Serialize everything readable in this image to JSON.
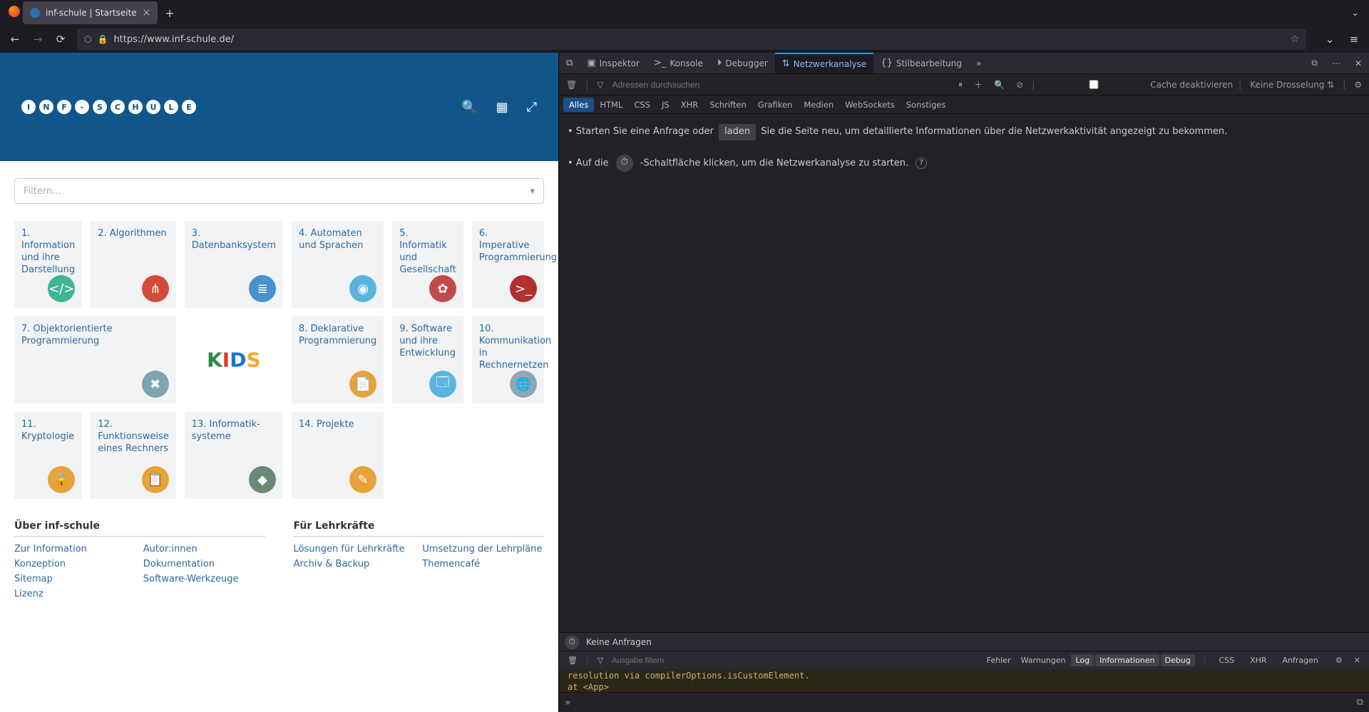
{
  "browser": {
    "tabTitle": "inf-schule | Startseite",
    "url": "https://www.inf-schule.de/",
    "newTab": "+",
    "nav": {
      "back": "←",
      "forward": "→",
      "reload": "⟳"
    }
  },
  "page": {
    "logoLetters": [
      "I",
      "N",
      "F",
      "-",
      "S",
      "C",
      "H",
      "U",
      "L",
      "E"
    ],
    "filterPlaceholder": "Filtern…",
    "tiles": [
      {
        "t": "1. Information und ihre Darstellung",
        "c": "#3fb597",
        "g": "</>"
      },
      {
        "t": "2. Algorithmen",
        "c": "#d14b3a",
        "g": "⋔"
      },
      {
        "t": "3. Datenbanksystem",
        "c": "#4b90cf",
        "g": "≣"
      },
      {
        "t": "4. Automaten und Sprachen",
        "c": "#5bb4e0",
        "g": "◉"
      },
      {
        "t": "5. Informatik und Gesellschaft",
        "c": "#c34a4a",
        "g": "✿"
      },
      {
        "t": "6. Imperative Programmierung",
        "c": "#b33030",
        "g": ">_",
        "wide": true
      },
      {
        "t": "7. Objektorientierte Programmierung",
        "c": "#7da4b3",
        "g": "✖",
        "wide": true
      },
      {
        "kids": true,
        "white": true
      },
      {
        "t": "8. Deklarative Programmierung",
        "c": "#e8a23a",
        "g": "📄"
      },
      {
        "t": "9. Software und ihre Entwicklung",
        "c": "#5bb4e0",
        "g": "🗔"
      },
      {
        "t": "10. Kommunikation in Rechnernetzen",
        "c": "#8fa7b3",
        "g": "🌐",
        "wide": true
      },
      {
        "t": "11. Kryptologie",
        "c": "#e8a23a",
        "g": "🔒"
      },
      {
        "t": "12. Funktionsweise eines Rechners",
        "c": "#e8a23a",
        "g": "📋"
      },
      {
        "t": "13. Informatik­systeme",
        "c": "#6a8a74",
        "g": "◆"
      },
      {
        "t": "14. Projekte",
        "c": "#e8a23a",
        "g": "✎"
      }
    ],
    "footer": {
      "about": {
        "h": "Über inf-schule",
        "links": [
          "Zur Information",
          "Autor:innen",
          "Konzeption",
          "Dokumentation",
          "Sitemap",
          "Software-Werkzeuge",
          "Lizenz"
        ]
      },
      "teach": {
        "h": "Für Lehrkräfte",
        "links": [
          "Lösungen für Lehrkräfte",
          "Umsetzung der Lehrpläne",
          "Archiv & Backup",
          "Themencafé"
        ]
      }
    }
  },
  "devtools": {
    "tabs": [
      "Inspektor",
      "Konsole",
      "Debugger",
      "Netzwerkanalyse",
      "Stilbearbeitung"
    ],
    "activeTab": "Netzwerkanalyse",
    "toolbar": {
      "searchPlaceholder": "Adressen durchsuchen",
      "cacheLabel": "Cache deaktivieren",
      "throttleLabel": "Keine Drosselung"
    },
    "filters": [
      "Alles",
      "HTML",
      "CSS",
      "JS",
      "XHR",
      "Schriften",
      "Grafiken",
      "Medien",
      "WebSockets",
      "Sonstiges"
    ],
    "msg1a": "• Starten Sie eine Anfrage oder",
    "msg1btn": "laden",
    "msg1b": "Sie die Seite neu, um detaillierte Informationen über die Netzwerkaktivität angezeigt zu bekommen.",
    "msg2a": "• Auf die",
    "msg2b": "-Schaltfläche klicken, um die Netzwerkanalyse zu starten.",
    "status": "Keine Anfragen",
    "consoleFilter": {
      "placeholder": "Ausgabe filtern",
      "btns": [
        "Fehler",
        "Warnungen",
        "Log",
        "Informationen",
        "Debug"
      ],
      "right": [
        "CSS",
        "XHR",
        "Anfragen"
      ]
    },
    "consoleOut1": "resolution via compilerOptions.isCustomElement.",
    "consoleOut2": "   at <App>"
  }
}
